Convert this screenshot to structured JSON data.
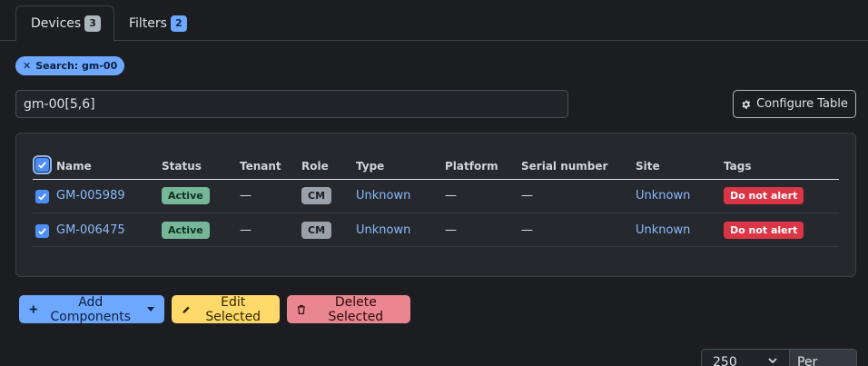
{
  "tabs": [
    {
      "label": "Devices",
      "count": "3"
    },
    {
      "label": "Filters",
      "count": "2"
    }
  ],
  "filter_chip": {
    "label": "Search: gm-00"
  },
  "search": {
    "value": "gm-00[5,6]"
  },
  "configure_table_label": "Configure Table",
  "table": {
    "headers": [
      "Name",
      "Status",
      "Tenant",
      "Role",
      "Type",
      "Platform",
      "Serial number",
      "Site",
      "Tags"
    ],
    "rows": [
      {
        "name": "GM-005989",
        "status": "Active",
        "tenant": "—",
        "role": "CM",
        "type": "Unknown",
        "platform": "—",
        "serial": "—",
        "site": "Unknown",
        "tag": "Do not alert"
      },
      {
        "name": "GM-006475",
        "status": "Active",
        "tenant": "—",
        "role": "CM",
        "type": "Unknown",
        "platform": "—",
        "serial": "—",
        "site": "Unknown",
        "tag": "Do not alert"
      }
    ]
  },
  "actions": {
    "add_components": "Add Components",
    "edit_selected": "Edit Selected",
    "delete_selected": "Delete Selected"
  },
  "pagination": {
    "per_page_value": "250",
    "per_page_label": "Per Page"
  },
  "colors": {
    "primary": "#6ea8fe",
    "success": "#75b798",
    "warning": "#ffda6a",
    "danger": "#ea868f",
    "tag_red": "#dc3545",
    "background": "#1b1d21"
  },
  "icons": {
    "chip_remove": "close-icon",
    "configure": "gear-icon",
    "add": "plus-icon",
    "edit": "pencil-icon",
    "delete": "trash-icon",
    "checkbox": "check-icon",
    "select": "chevron-down-icon"
  }
}
